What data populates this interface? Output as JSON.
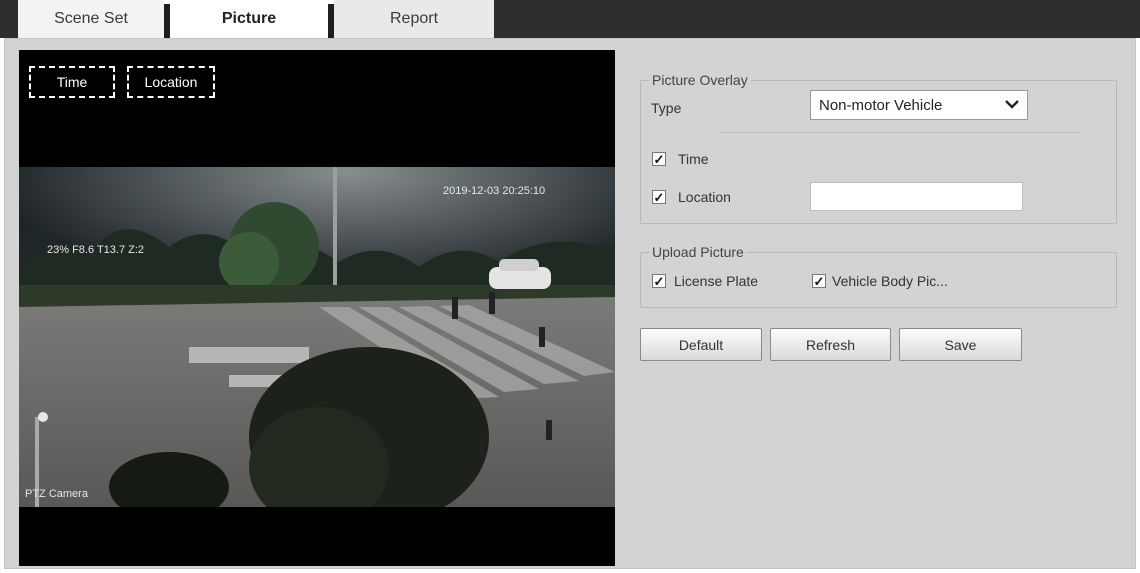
{
  "tabs": [
    {
      "label": "Scene Set",
      "active": false
    },
    {
      "label": "Picture",
      "active": true
    },
    {
      "label": "Report",
      "active": false
    }
  ],
  "video": {
    "osd_time_label": "Time",
    "osd_location_label": "Location",
    "timestamp": "2019-12-03 20:25:10",
    "ptz_info": "23% F8.6 T13.7 Z:2",
    "camera_name": "PTZ Camera"
  },
  "picture_overlay": {
    "legend": "Picture Overlay",
    "type_label": "Type",
    "type_value": "Non-motor Vehicle",
    "time_label": "Time",
    "time_checked": true,
    "location_label": "Location",
    "location_checked": true,
    "location_value": ""
  },
  "upload_picture": {
    "legend": "Upload Picture",
    "license_plate_label": "License Plate",
    "license_plate_checked": true,
    "vehicle_body_label": "Vehicle Body Pic...",
    "vehicle_body_checked": true
  },
  "buttons": {
    "default": "Default",
    "refresh": "Refresh",
    "save": "Save"
  },
  "colors": {
    "panel_bg": "#d3d3d3",
    "tabbar_dark": "#2e2e2e"
  }
}
